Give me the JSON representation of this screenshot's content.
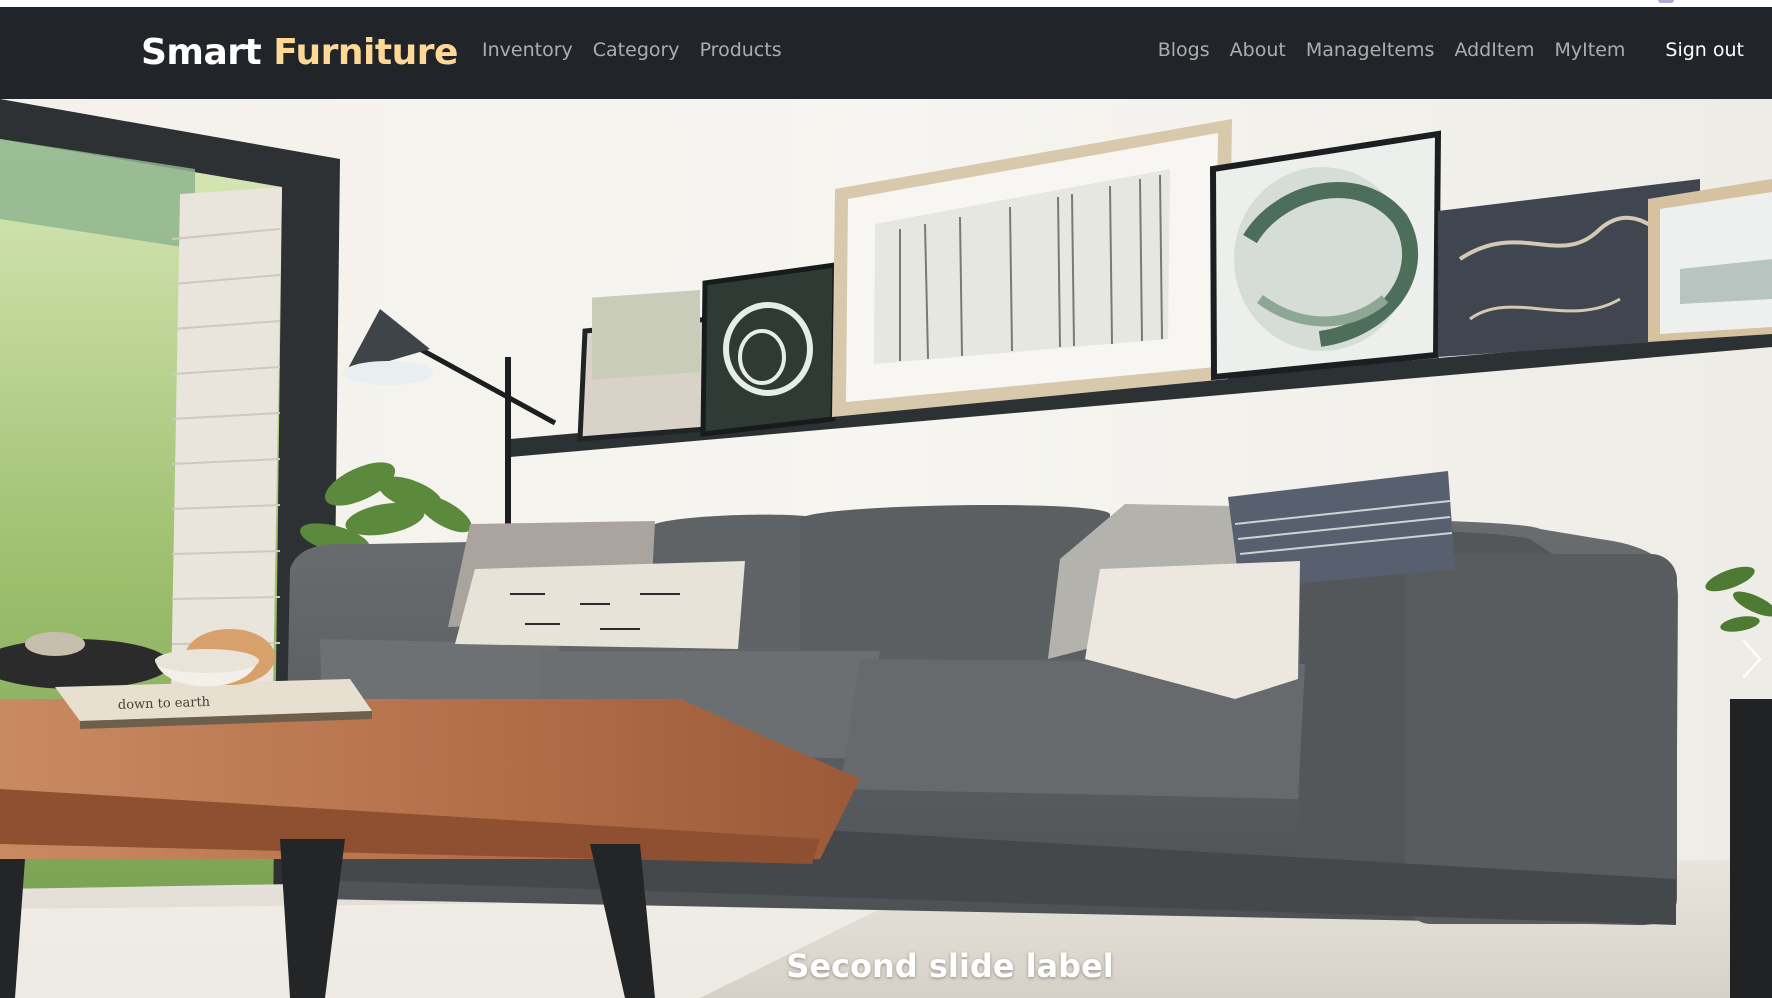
{
  "navbar": {
    "brand": {
      "part1": "Smart",
      "part2": "Furniture"
    },
    "left_links": [
      "Inventory",
      "Category",
      "Products"
    ],
    "right_links": [
      "Blogs",
      "About",
      "ManageItems",
      "AddItem",
      "MyItem"
    ],
    "sign_out_label": "Sign out"
  },
  "carousel": {
    "caption_label": "Second slide label",
    "book_title": "down to earth",
    "next_icon": "chevron-right-icon"
  },
  "colors": {
    "navbar_bg": "#212529",
    "brand_accent": "#ffd896",
    "sofa": "#5d6063",
    "table_wood": "#b7704a"
  }
}
